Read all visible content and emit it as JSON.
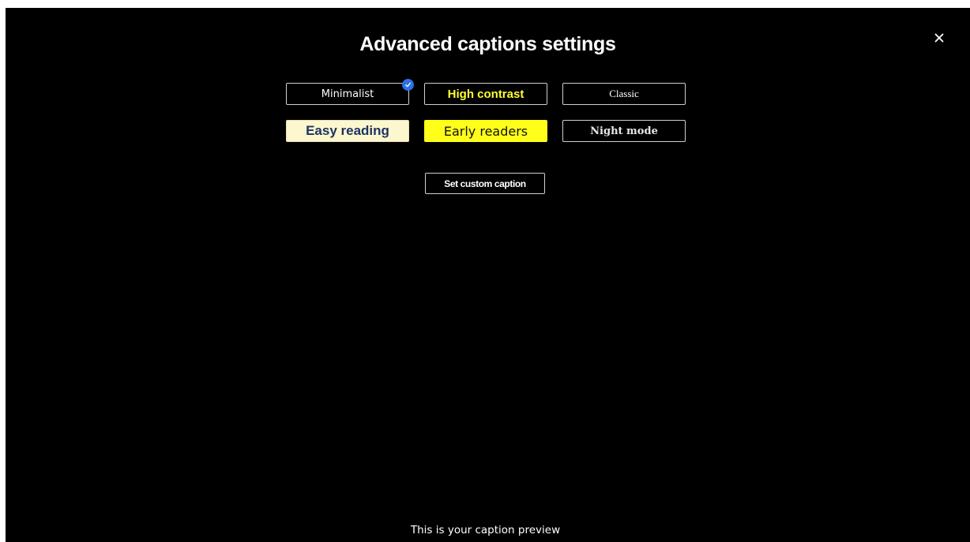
{
  "dialog": {
    "title": "Advanced captions settings",
    "close_icon": "close-icon"
  },
  "presets": [
    {
      "label": "Minimalist",
      "selected": true
    },
    {
      "label": "High contrast",
      "selected": false
    },
    {
      "label": "Classic",
      "selected": false
    },
    {
      "label": "Easy reading",
      "selected": false
    },
    {
      "label": "Early readers",
      "selected": false
    },
    {
      "label": "Night mode",
      "selected": false
    }
  ],
  "custom_button": {
    "label": "Set custom caption"
  },
  "preview": {
    "text": "This is your caption preview"
  },
  "colors": {
    "background": "#000000",
    "selected_badge": "#2f6fe4",
    "high_contrast_text": "#ffff33",
    "easy_reading_bg": "#fdf7cf",
    "easy_reading_text": "#1d3461",
    "early_readers_bg": "#ffff1a"
  }
}
